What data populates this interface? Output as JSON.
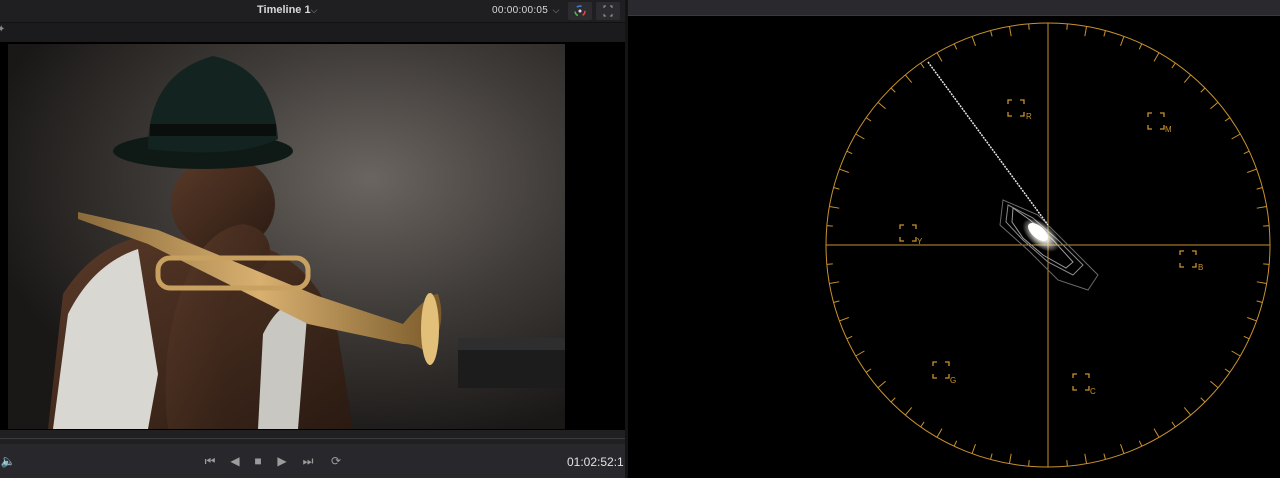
{
  "viewer": {
    "timeline_name": "Timeline 1",
    "timecode_top": "00:00:00:05",
    "timecode_bottom": "01:02:52:1"
  },
  "icons": {
    "timeline_dropdown": "chevron-down-icon",
    "timecode_dropdown": "chevron-down-icon",
    "color_viewer": "color-wheel-icon",
    "fullscreen": "expand-icon",
    "volume": "speaker-icon",
    "skip_start": "skip-to-start-icon",
    "play_reverse": "play-reverse-icon",
    "stop": "stop-icon",
    "play": "play-icon",
    "skip_end": "skip-to-end-icon",
    "loop": "loop-icon"
  },
  "scope": {
    "type": "vectorscope",
    "graticule_color": "#c9922e",
    "targets": [
      {
        "label": "R"
      },
      {
        "label": "M"
      },
      {
        "label": "Y"
      },
      {
        "label": "B"
      },
      {
        "label": "G"
      },
      {
        "label": "C"
      }
    ]
  },
  "colors": {
    "panel_bg": "#28282c",
    "graticule": "#c9922e",
    "text": "#d8d8d8"
  }
}
